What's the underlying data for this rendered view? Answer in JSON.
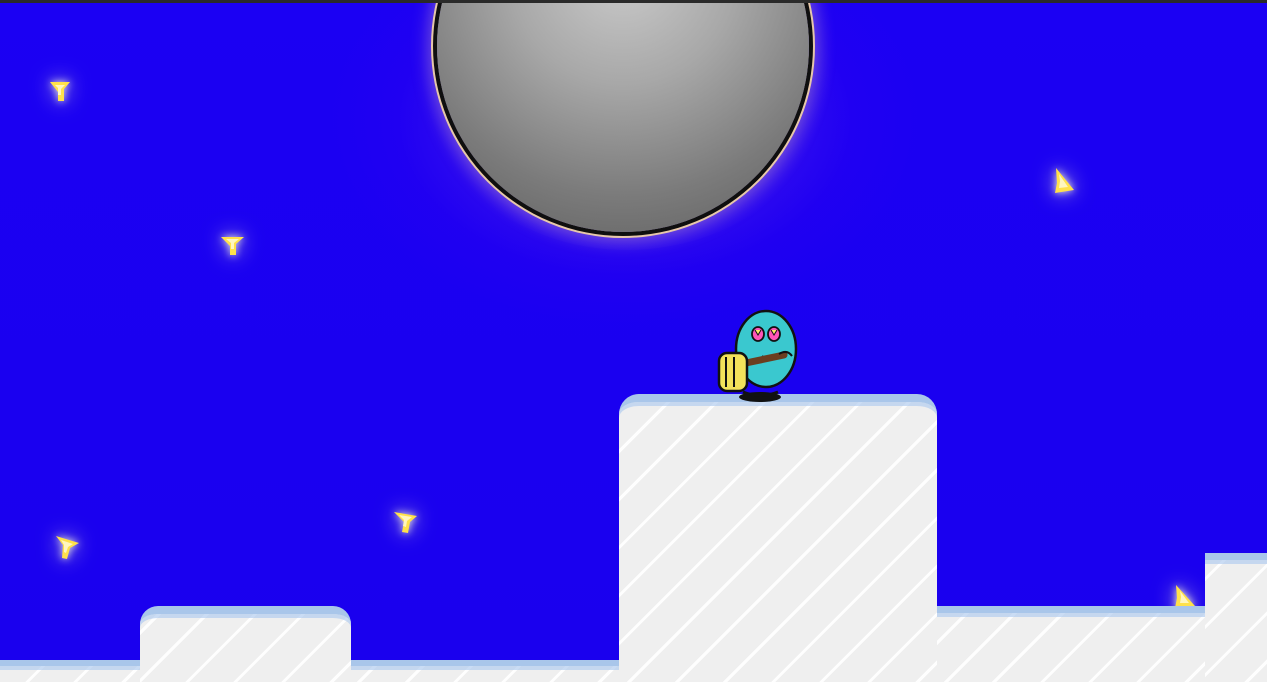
{
  "scene": {
    "sky_color": "#1a00f0",
    "moon": {
      "color": "#9b9b9b",
      "rim_color": "#111111",
      "glow_color": "#ffe1a0"
    },
    "star_color": "#ffe14a",
    "stars": [
      {
        "name": "star-1"
      },
      {
        "name": "star-2"
      },
      {
        "name": "star-3"
      },
      {
        "name": "star-4"
      },
      {
        "name": "star-5"
      },
      {
        "name": "star-6"
      },
      {
        "name": "star-7"
      }
    ],
    "platforms": {
      "fill_color": "#efefef",
      "edge_color": "#a9c6ea"
    },
    "player": {
      "body_color": "#3ac8cf",
      "eye_color": "#ff55b8",
      "hammer_color": "#f3e25a",
      "handle_color": "#6b3d1f",
      "icon": "player-character-icon"
    }
  }
}
